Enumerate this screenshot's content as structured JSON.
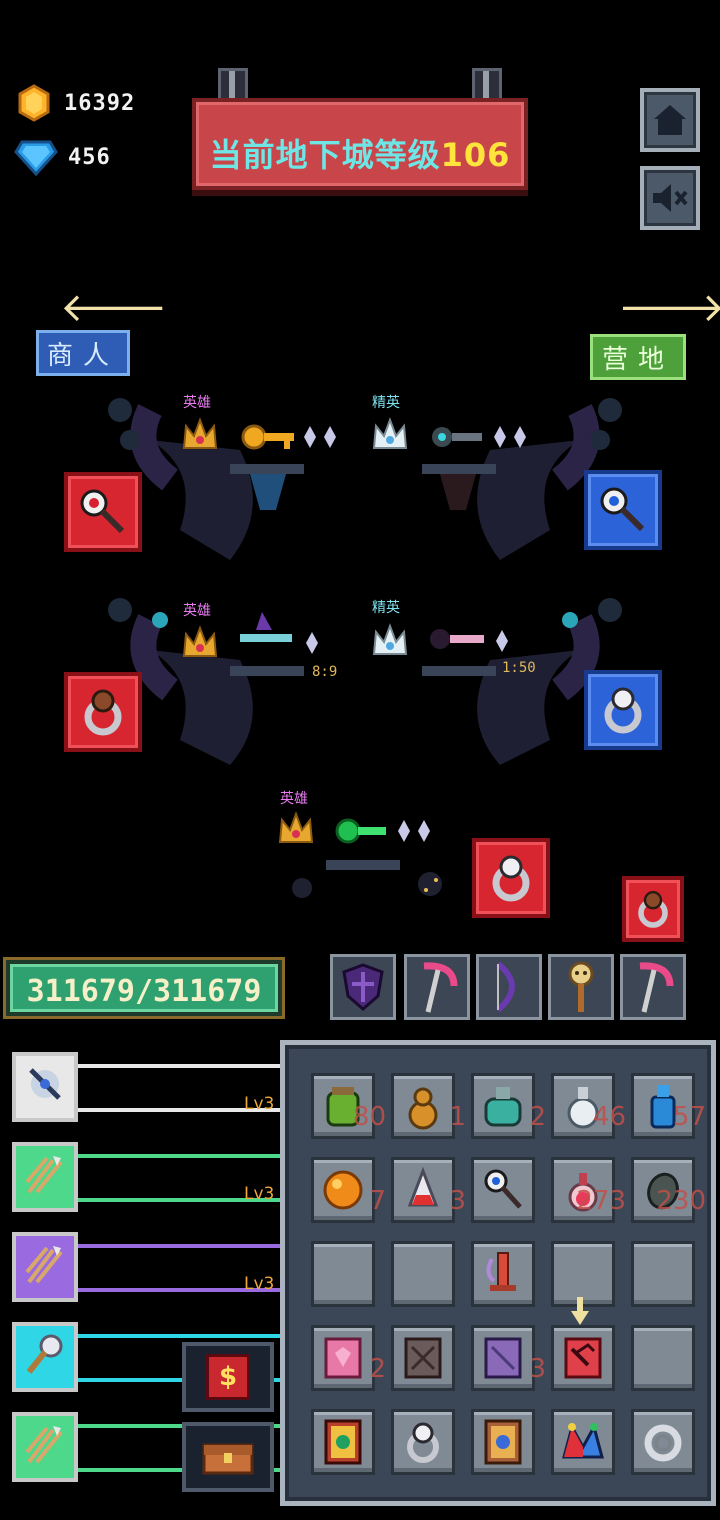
{
  "resources": {
    "gold": "16392",
    "gems": "456"
  },
  "banner": {
    "prefix": "当前地下城等级",
    "level": "106"
  },
  "nav": {
    "left_label": "商人",
    "right_label": "营地",
    "left_arrow": "🡐",
    "right_arrow": "🡒"
  },
  "altars": {
    "top_left_tag": "英雄",
    "top_right_tag": "精英",
    "mid_left_tag": "英雄",
    "mid_right_tag": "精英",
    "bottom_tag": "英雄",
    "mid_left_timer": "8:9",
    "mid_right_timer": "1:50"
  },
  "hp": {
    "text": "311679/311679"
  },
  "skills": [
    {
      "level": "Lv3",
      "color": "#e8e8e8",
      "icon": "crossbow-icon"
    },
    {
      "level": "Lv3",
      "color": "#4ed88c",
      "icon": "arrows-icon"
    },
    {
      "level": "Lv3",
      "color": "#9a6ae0",
      "icon": "arrows-icon"
    },
    {
      "level": "",
      "color": "#2fd6e6",
      "icon": "mace-icon"
    },
    {
      "level": "",
      "color": "#4ed88c",
      "icon": "arrows-icon"
    }
  ],
  "inventory": {
    "counts": [
      "80",
      "1",
      "2",
      "46",
      "57",
      "7",
      "3",
      "",
      "273",
      "230",
      "",
      "",
      "",
      "",
      "",
      "2",
      "",
      "3",
      "",
      "",
      "",
      "",
      "",
      "",
      ""
    ]
  },
  "shop": {
    "symbol": "$"
  },
  "colors": {
    "banner": "#c8464a",
    "banner_text": "#6ee6e6",
    "level_text": "#ffe53b",
    "hero": "#e87cf0",
    "elite": "#7ee2f0"
  }
}
